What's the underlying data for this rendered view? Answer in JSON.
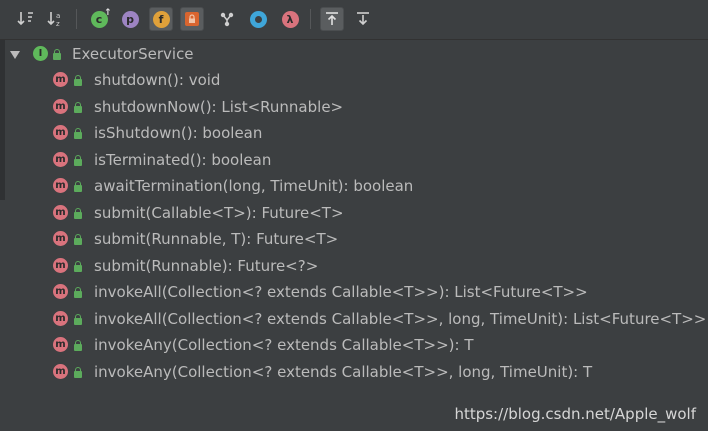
{
  "toolbar": {
    "buttons": [
      {
        "name": "sort-by-visibility",
        "icon": "sort-down-arrow-icon"
      },
      {
        "name": "sort-alphabetically",
        "icon": "sort-az-icon"
      },
      {
        "name": "show-inherited",
        "icon": "class-inherited-icon"
      },
      {
        "name": "show-properties",
        "icon": "property-p-icon",
        "glyph": "p"
      },
      {
        "name": "show-fields",
        "icon": "field-f-icon",
        "glyph": "f",
        "active": true
      },
      {
        "name": "show-non-public",
        "icon": "lock-icon",
        "active": true
      },
      {
        "name": "show-anonymous",
        "icon": "anonymous-y-icon"
      },
      {
        "name": "show-lambdas-ring",
        "icon": "ring-icon"
      },
      {
        "name": "show-lambdas",
        "icon": "lambda-icon",
        "glyph": "λ"
      },
      {
        "name": "autoscroll-to-source",
        "icon": "scroll-to-source-icon",
        "active": true
      },
      {
        "name": "autoscroll-from-source",
        "icon": "scroll-from-source-icon"
      }
    ]
  },
  "tree": {
    "root": {
      "label": "ExecutorService",
      "icon": "interface-icon",
      "glyph": "I"
    },
    "methods": [
      {
        "label": "shutdown(): void"
      },
      {
        "label": "shutdownNow(): List<Runnable>"
      },
      {
        "label": "isShutdown(): boolean"
      },
      {
        "label": "isTerminated(): boolean"
      },
      {
        "label": "awaitTermination(long, TimeUnit): boolean"
      },
      {
        "label": "submit(Callable<T>): Future<T>"
      },
      {
        "label": "submit(Runnable, T): Future<T>"
      },
      {
        "label": "submit(Runnable): Future<?>"
      },
      {
        "label": "invokeAll(Collection<? extends Callable<T>>): List<Future<T>>"
      },
      {
        "label": "invokeAll(Collection<? extends Callable<T>>, long, TimeUnit): List<Future<T>>"
      },
      {
        "label": "invokeAny(Collection<? extends Callable<T>>): T"
      },
      {
        "label": "invokeAny(Collection<? extends Callable<T>>, long, TimeUnit): T"
      }
    ],
    "method_glyph": "m"
  },
  "watermark": "https://blog.csdn.net/Apple_wolf",
  "colors": {
    "background": "#3c3f41",
    "text": "#bbbbbb",
    "method_icon": "#d9737d",
    "interface_icon": "#5fb95b",
    "lock": "#5cab5c"
  }
}
